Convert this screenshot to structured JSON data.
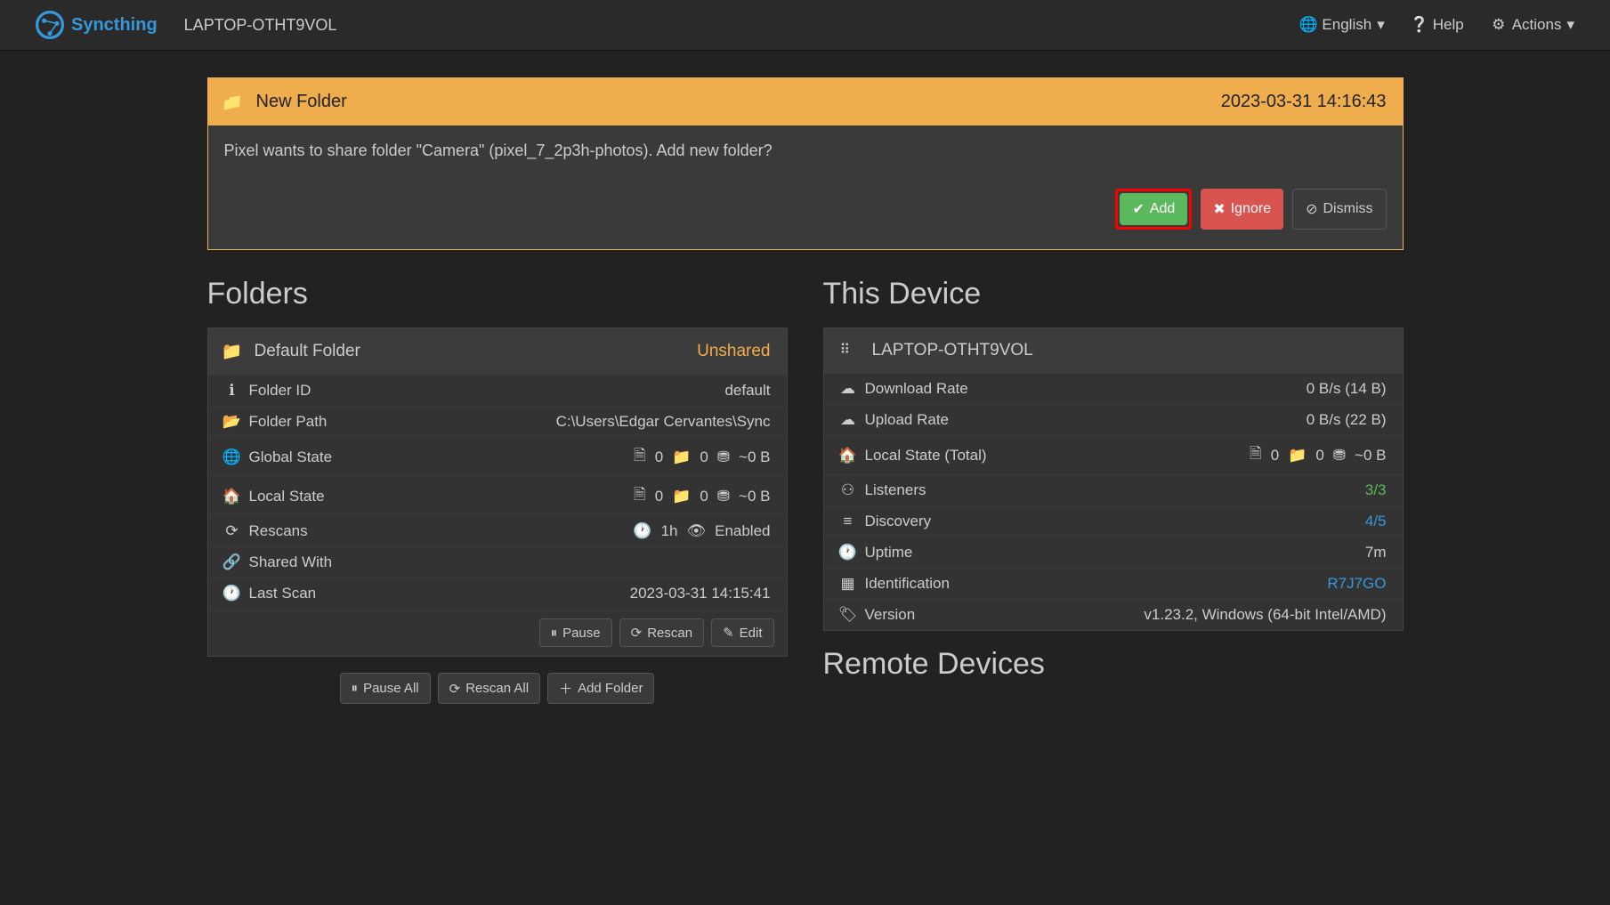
{
  "navbar": {
    "brand": "Syncthing",
    "device_name": "LAPTOP-OTHT9VOL",
    "lang": "English",
    "help": "Help",
    "actions": "Actions"
  },
  "notification": {
    "title": "New Folder",
    "timestamp": "2023-03-31 14:16:43",
    "message": "Pixel wants to share folder \"Camera\" (pixel_7_2p3h-photos). Add new folder?",
    "add": "Add",
    "ignore": "Ignore",
    "dismiss": "Dismiss"
  },
  "sections": {
    "folders_title": "Folders",
    "this_device_title": "This Device",
    "remote_devices_title": "Remote Devices"
  },
  "folder": {
    "name": "Default Folder",
    "status": "Unshared",
    "rows": {
      "folder_id_label": "Folder ID",
      "folder_id_value": "default",
      "folder_path_label": "Folder Path",
      "folder_path_value": "C:\\Users\\Edgar Cervantes\\Sync",
      "global_state_label": "Global State",
      "gs_files": "0",
      "gs_dirs": "0",
      "gs_size": "~0 B",
      "local_state_label": "Local State",
      "ls_files": "0",
      "ls_dirs": "0",
      "ls_size": "~0 B",
      "rescans_label": "Rescans",
      "rescans_interval": "1h",
      "rescans_watch": "Enabled",
      "shared_with_label": "Shared With",
      "last_scan_label": "Last Scan",
      "last_scan_value": "2023-03-31 14:15:41"
    },
    "buttons": {
      "pause": "Pause",
      "rescan": "Rescan",
      "edit": "Edit"
    }
  },
  "global_buttons": {
    "pause_all": "Pause All",
    "rescan_all": "Rescan All",
    "add_folder": "Add Folder"
  },
  "device": {
    "name": "LAPTOP-OTHT9VOL",
    "rows": {
      "download_label": "Download Rate",
      "download_value": "0 B/s (14 B)",
      "upload_label": "Upload Rate",
      "upload_value": "0 B/s (22 B)",
      "local_state_label": "Local State (Total)",
      "lst_files": "0",
      "lst_dirs": "0",
      "lst_size": "~0 B",
      "listeners_label": "Listeners",
      "listeners_value": "3/3",
      "discovery_label": "Discovery",
      "discovery_value": "4/5",
      "uptime_label": "Uptime",
      "uptime_value": "7m",
      "identification_label": "Identification",
      "identification_value": "R7J7GO",
      "version_label": "Version",
      "version_value": "v1.23.2, Windows (64-bit Intel/AMD)"
    }
  }
}
